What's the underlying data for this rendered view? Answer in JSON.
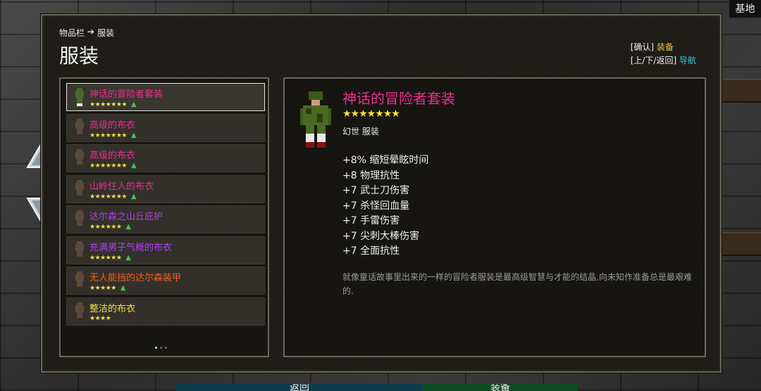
{
  "header": {
    "base_button": "基地",
    "breadcrumb_parent": "物品栏",
    "breadcrumb_arrow": "➔",
    "breadcrumb_current": "服装",
    "title": "服装"
  },
  "hints": [
    {
      "key": "[确认]",
      "action": "装备",
      "color": "#e8c83a"
    },
    {
      "key": "[上/下/返回]",
      "action": "导航",
      "color": "#3cc8e0"
    }
  ],
  "items": [
    {
      "name": "神话的冒险者套装",
      "name_color": "#e8308c",
      "stars": "★★★★★★★",
      "up": "▲",
      "selected": true
    },
    {
      "name": "高级的布衣",
      "name_color": "#e8308c",
      "stars": "★★★★★★★",
      "up": "▲",
      "selected": false
    },
    {
      "name": "高级的布衣",
      "name_color": "#e8308c",
      "stars": "★★★★★★★",
      "up": "▲",
      "selected": false
    },
    {
      "name": "山岭住人的布衣",
      "name_color": "#e8308c",
      "stars": "★★★★★★★",
      "up": "▲",
      "selected": false
    },
    {
      "name": "达尔森之山丘庇护",
      "name_color": "#b040f0",
      "stars": "★★★★★★",
      "up": "▲",
      "selected": false
    },
    {
      "name": "充满男子气概的布衣",
      "name_color": "#b040f0",
      "stars": "★★★★★★",
      "up": "▲",
      "selected": false
    },
    {
      "name": "无人能挡的达尔森装甲",
      "name_color": "#f06020",
      "stars": "★★★★★",
      "up": "▲",
      "selected": false
    },
    {
      "name": "整洁的布衣",
      "name_color": "#f0e040",
      "stars": "★★★★",
      "up": "",
      "selected": false
    }
  ],
  "pagination": {
    "pages": 3,
    "current": 1
  },
  "detail": {
    "name": "神话的冒险者套装",
    "stars": "★★★★★★★",
    "type": "幻世 服装",
    "stats": [
      "+8% 缩短晕眩时间",
      "+8 物理抗性",
      "+7 武士刀伤害",
      "+7 杀怪回血量",
      "+7 手雷伤害",
      "+7 尖刺大棒伤害",
      "+7 全面抗性"
    ],
    "description": "就像童话故事里出来的一样的冒险者服装是最高级智慧与才能的结晶,向未知作准备总是最艰难的."
  },
  "bottom_tabs": {
    "back": "返回",
    "equip": "装备"
  },
  "icons": {
    "scroll_up": "up-arrow-icon",
    "scroll_down": "down-arrow-icon",
    "item_sprite": "outfit-sprite-icon",
    "upgrade": "upgrade-arrow-icon"
  }
}
